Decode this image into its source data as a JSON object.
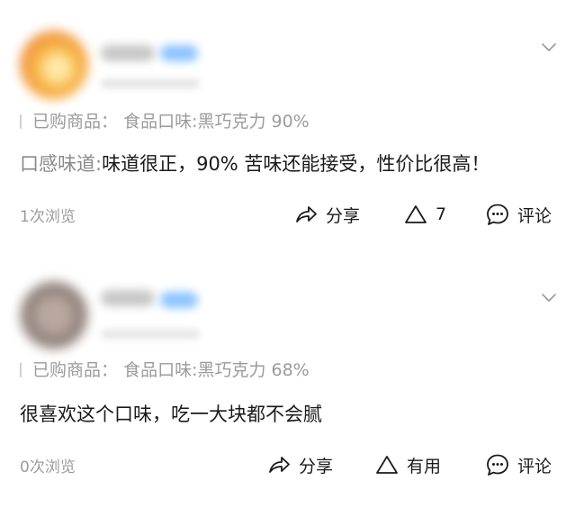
{
  "reviews": [
    {
      "purchase_label": "已购商品：",
      "purchase_value": "食品口味:黑巧克力 90%",
      "content_label": "口感味道:",
      "content_text": "味道很正，90% 苦味还能接受，性价比很高！",
      "views": "1次浏览",
      "share_label": "分享",
      "useful_label": "7",
      "comment_label": "评论"
    },
    {
      "purchase_label": "已购商品：",
      "purchase_value": "食品口味:黑巧克力 68%",
      "content_label": "",
      "content_text": "很喜欢这个口味，吃一大块都不会腻",
      "views": "0次浏览",
      "share_label": "分享",
      "useful_label": "有用",
      "comment_label": "评论"
    }
  ],
  "icons": {
    "expand": "chevron-down-icon",
    "share": "share-icon",
    "useful": "triangle-up-icon",
    "comment": "comment-icon"
  },
  "colors": {
    "text_primary": "#1a1a1a",
    "text_secondary": "#9b9b9b",
    "username_tag": "#8dc3ff"
  }
}
